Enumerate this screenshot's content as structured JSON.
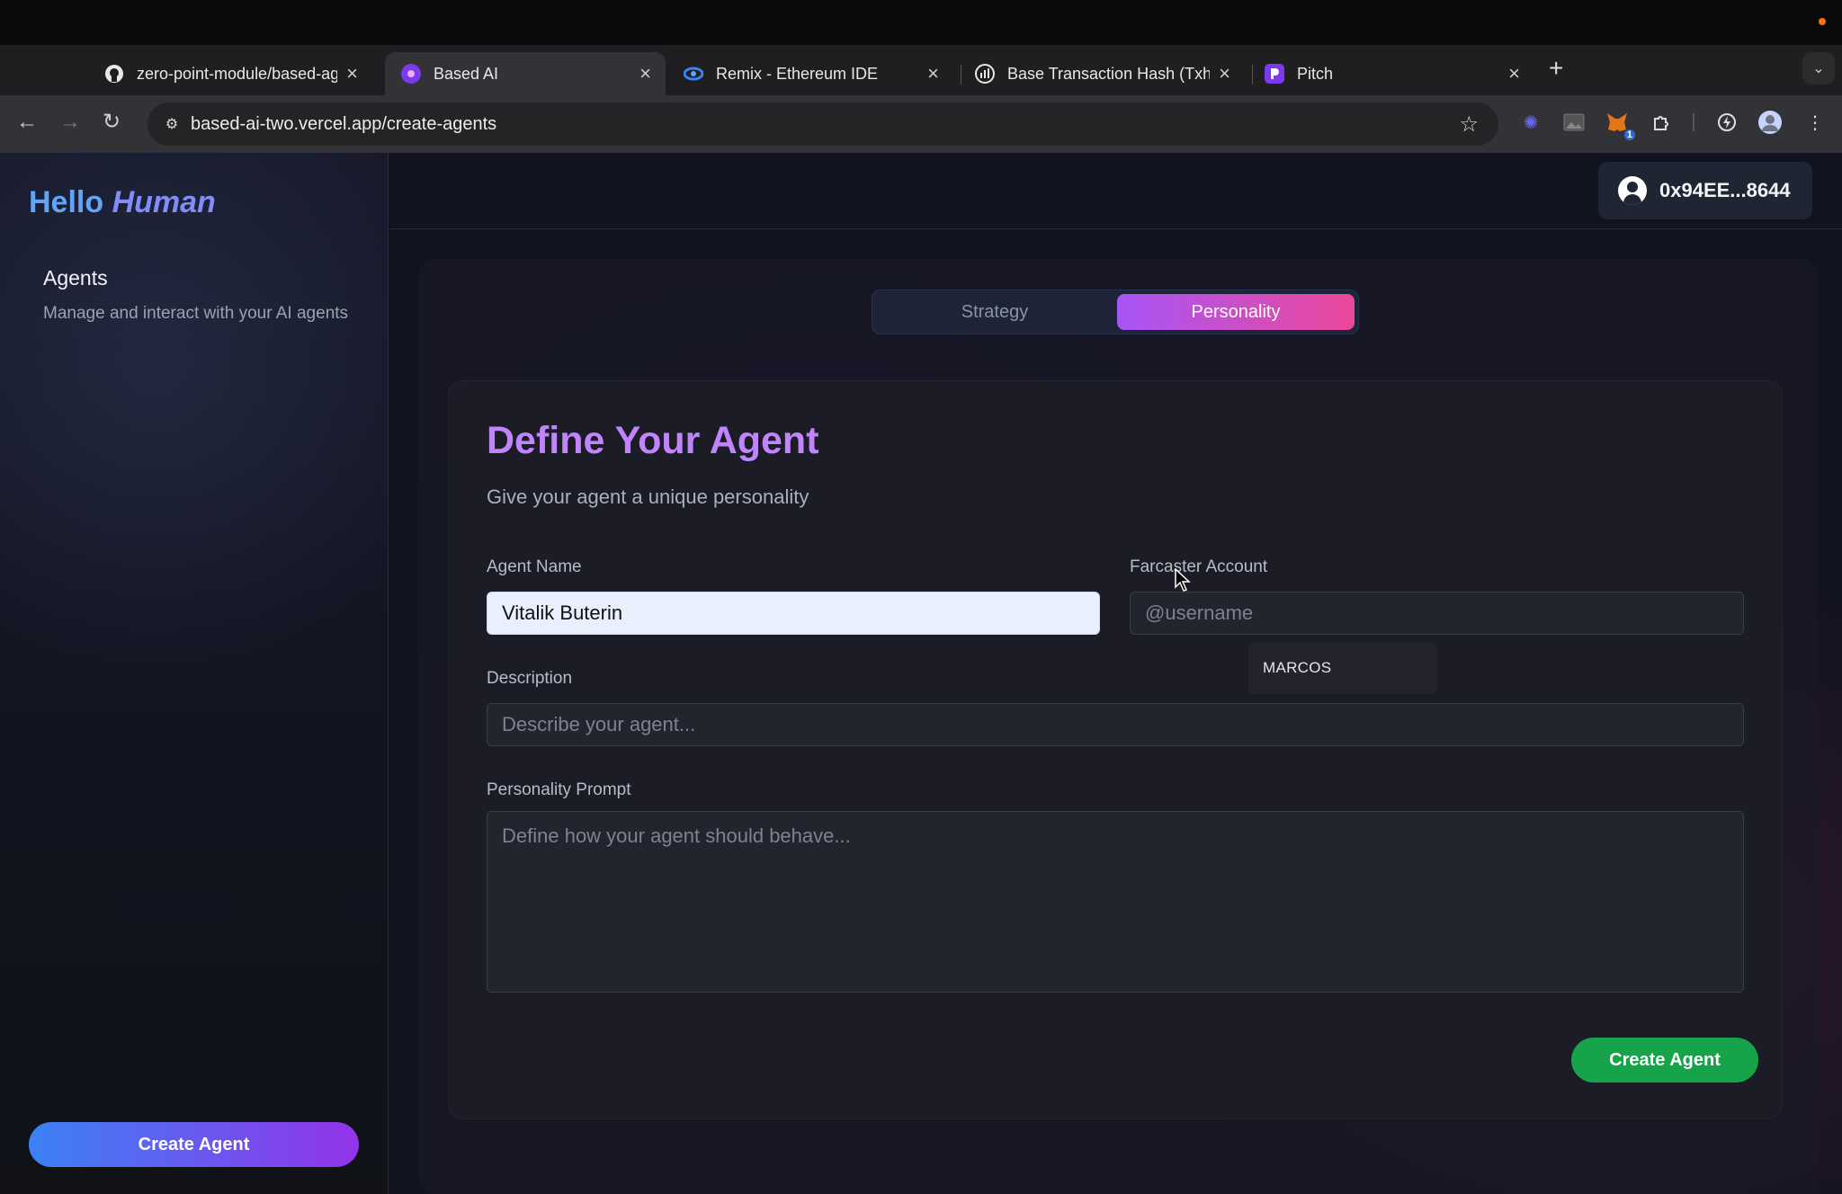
{
  "browser": {
    "tabs": [
      {
        "title": "zero-point-module/based-ag",
        "icon": "github-icon"
      },
      {
        "title": "Based AI",
        "icon": "based-ai-icon"
      },
      {
        "title": "Remix - Ethereum IDE",
        "icon": "remix-icon"
      },
      {
        "title": "Base Transaction Hash (Txhas",
        "icon": "basescan-icon"
      },
      {
        "title": "Pitch",
        "icon": "pitch-icon"
      }
    ],
    "active_tab_index": 1,
    "url": "based-ai-two.vercel.app/create-agents",
    "extension_badge": "1"
  },
  "sidebar": {
    "brand_hello": "Hello",
    "brand_human": "Human",
    "nav_title": "Agents",
    "nav_desc": "Manage and interact with your AI agents",
    "create_button": "Create Agent"
  },
  "header": {
    "wallet_address": "0x94EE...8644"
  },
  "toggle": {
    "strategy": "Strategy",
    "personality": "Personality",
    "active": "Personality"
  },
  "form": {
    "title": "Define Your Agent",
    "subtitle": "Give your agent a unique personality",
    "agent_name_label": "Agent Name",
    "agent_name_value": "Vitalik Buterin",
    "farcaster_label": "Farcaster Account",
    "farcaster_placeholder": "@username",
    "suggestion": "MARCOS",
    "description_label": "Description",
    "description_placeholder": "Describe your agent...",
    "prompt_label": "Personality Prompt",
    "prompt_placeholder": "Define how your agent should behave...",
    "submit": "Create Agent"
  },
  "colors": {
    "accent_purple": "#c084fc",
    "toggle_gradient_start": "#a855f7",
    "toggle_gradient_end": "#ec4899",
    "create_green": "#16a34a",
    "sidebar_button_start": "#3b82f6",
    "sidebar_button_end": "#9333ea"
  }
}
